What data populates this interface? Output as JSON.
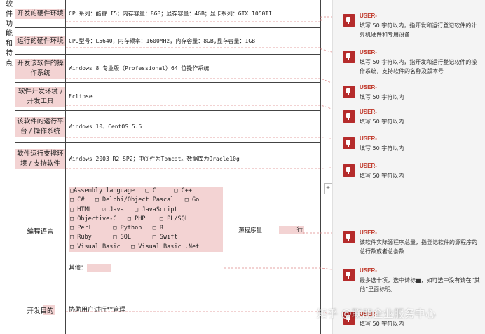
{
  "side_label": [
    "软",
    "件",
    "功",
    "能",
    "和",
    "特",
    "点"
  ],
  "rows": [
    {
      "label": "开发的硬件环境",
      "value": "CPU系列：酷睿 I5；内存容量：8GB；显存容量：4GB；显卡系列：GTX 1050TI"
    },
    {
      "label": "运行的硬件环境",
      "value": "CPU型号：L5640，内存频率：1600MHz，内存容量：8GB,显存容量：1GB"
    },
    {
      "label": "开发该软件的操作系统",
      "value": "Windows 8 专业版（Professional）64 位操作系统"
    },
    {
      "label": "软件开发环境 / 开发工具",
      "value": "Eclipse"
    },
    {
      "label": "该软件的运行平台 / 操作系统",
      "value": "Windows 10、CentOS 5.5"
    },
    {
      "label": "软件运行支撑环境 / 支持软件",
      "value": "Windows 2003  R2 SP2；中间件为Tomcat。数据库为Oracle10g"
    }
  ],
  "language_row": {
    "label": "编程语言",
    "lines": [
      "□Assembly language   □ C     □ C++",
      "□ C#   □ Delphi/Object Pascal   □ Go",
      "□ HTML   ☑ Java   □ JavaScript",
      "□ Objective-C   □ PHP    □ PL/SQL",
      "□ Perl      □ Python   □ R",
      "□ Ruby      □ SQL      □ Swift",
      "□ Visual Basic   □ Visual Basic .Net"
    ],
    "other_label": "其他：",
    "source_lines_label": "源程序量",
    "source_lines_unit": "行"
  },
  "purpose_row": {
    "label": "开发目的",
    "value": "协助用户进行**管理"
  },
  "comments": [
    {
      "author": "USER-",
      "text": "填写 50 字符以内，指开发和运行登记软件的计算机硬件和专用设备"
    },
    {
      "author": "USER-",
      "text": "填写 50 字符以内，指开发和运行登记软件的操作系统，支持软件的名称及版本号"
    },
    {
      "author": "USER-",
      "text": "填写 50 字符以内"
    },
    {
      "author": "USER-",
      "text": "填写 50 字符以内"
    },
    {
      "author": "USER-",
      "text": "填写 50 字符以内"
    },
    {
      "author": "USER-",
      "text": "填写 50 字符以内"
    },
    {
      "author": "USER-",
      "text": "该软件实际源程序总量，指登记软件的源程序的总行数或者总条数"
    },
    {
      "author": "USER-",
      "text": "最多选十项，选中请标■，如可选中没有请在“其他”里面标明。"
    },
    {
      "author": "USER-",
      "text": "填写 50 字符以内"
    }
  ],
  "add_button": "+",
  "watermark": "知乎 @联朋企业服务中心",
  "colors": {
    "highlight": "#f3d3d3",
    "comment_accent": "#b52b2b",
    "connector": "#d88"
  }
}
